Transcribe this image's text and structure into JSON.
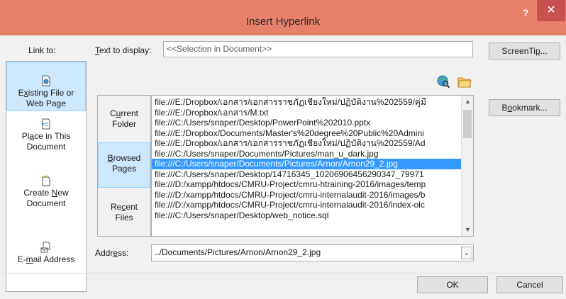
{
  "window": {
    "title": "Insert Hyperlink",
    "help_glyph": "?",
    "close_glyph": "✕"
  },
  "link_to": {
    "label": "Link to:",
    "items": [
      {
        "label_parts": [
          "E",
          "x",
          "isting File or"
        ],
        "line2": "Web Page",
        "icon": "existing-file-icon",
        "selected": true
      },
      {
        "label_parts": [
          "Pl",
          "a",
          "ce in This"
        ],
        "line2": "Document",
        "icon": "place-in-document-icon",
        "selected": false
      },
      {
        "label_parts": [
          "Create ",
          "N",
          "ew"
        ],
        "line2": "Document",
        "icon": "create-new-document-icon",
        "selected": false
      },
      {
        "label_parts": [
          "E-",
          "m",
          "ail Address"
        ],
        "line2": "",
        "icon": "email-address-icon",
        "selected": false
      }
    ]
  },
  "text_to_display": {
    "label_first": "T",
    "label_rest": "ext to display:",
    "value": "<<Selection in Document>>"
  },
  "buttons": {
    "screentip_pre": "ScreenTi",
    "screentip_u": "p",
    "screentip_post": "...",
    "bookmark_pre": "B",
    "bookmark_u": "o",
    "bookmark_post": "okmark...",
    "ok": "OK",
    "cancel": "Cancel"
  },
  "look_in": {
    "items": [
      {
        "pre": "C",
        "u": "u",
        "post": "rrent",
        "line2": "Folder",
        "selected": false
      },
      {
        "pre": "",
        "u": "B",
        "post": "rowsed",
        "line2": "Pages",
        "selected": true
      },
      {
        "pre": "Re",
        "u": "c",
        "post": "ent",
        "line2": "Files",
        "selected": false
      }
    ]
  },
  "files": [
    "file:///E:/Dropbox/เอกสาร/เอกสารราชภัฏเชียงใหม่/ปฏิบัติงาน%202559/คู่มื",
    "file:///E:/Dropbox/เอกสาร/M.txt",
    "file:///C:/Users/snaper/Desktop/PowerPoint%202010.pptx",
    "file:///E:/Dropbox/Documents/Master's%20degree%20Public%20Admini",
    "file:///E:/Dropbox/เอกสาร/เอกสารราชภัฏเชียงใหม่/ปฏิบัติงาน%202559/Ad",
    "file:///C:/Users/snaper/Documents/Pictures/man_u_dark.jpg",
    "file:///C:/Users/snaper/Documents/Pictures/Arnon/Arnon29_2.jpg",
    "file:///C:/Users/snaper/Desktop/14716345_10206906456290347_79971",
    "file:///D:/xampp/htdocs/CMRU-Project/cmru-htraining-2016/images/temp",
    "file:///D:/xampp/htdocs/CMRU-Project/cmru-internalaudit-2016/images/b",
    "file:///D:/xampp/htdocs/CMRU-Project/cmru-internalaudit-2016/index-olc",
    "file:///C:/Users/snaper/Desktop/web_notice.sql"
  ],
  "selected_file_index": 6,
  "address": {
    "label_pre": "Addr",
    "label_u": "e",
    "label_post": "ss:",
    "value": "../Documents/Pictures/Arnon/Arnon29_2.jpg"
  },
  "colors": {
    "titlebar": "#e7816b",
    "close": "#c75050",
    "selection": "#3399ff",
    "nav_selected": "#cce8ff"
  }
}
